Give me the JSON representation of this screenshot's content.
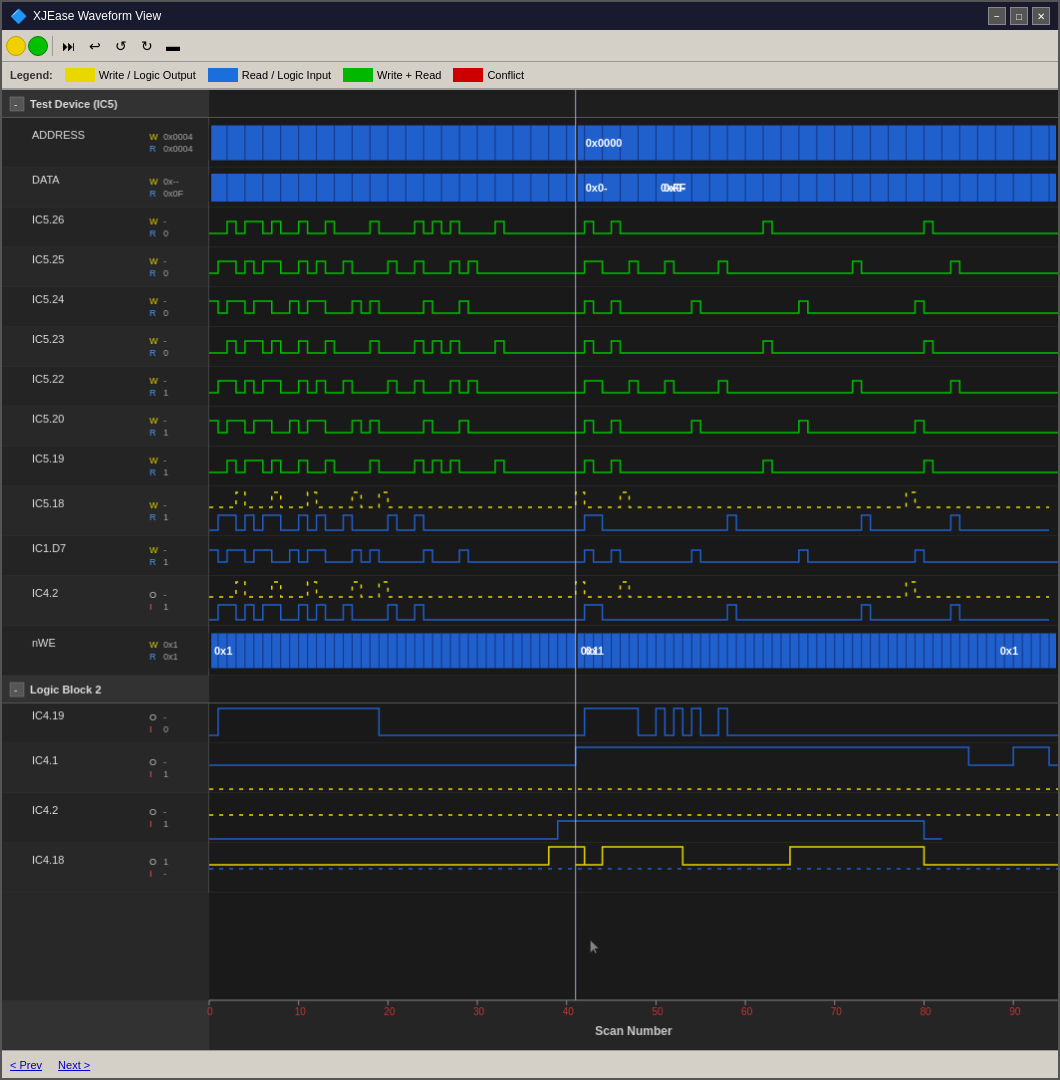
{
  "window": {
    "title": "XJEase Waveform View"
  },
  "legend": {
    "label": "Legend:",
    "items": [
      {
        "label": "Write / Logic Output",
        "color": "#e8d800",
        "class": "leg-yellow"
      },
      {
        "label": "Read / Logic Input",
        "color": "#1a6fdc",
        "class": "leg-blue"
      },
      {
        "label": "Write + Read",
        "color": "#00b800",
        "class": "leg-green"
      },
      {
        "label": "Conflict",
        "color": "#cc0000",
        "class": "leg-red"
      }
    ]
  },
  "groups": [
    {
      "name": "Test Device (IC5)",
      "expanded": true,
      "signals": [
        {
          "name": "ADDRESS",
          "w": "0x0004",
          "r": "0x0004",
          "type": "bus",
          "color": "#1a6fdc",
          "height": 50
        },
        {
          "name": "DATA",
          "w": "0x--",
          "r": "0x0F",
          "type": "bus",
          "color": "#1a6fdc",
          "height": 40
        },
        {
          "name": "IC5.26",
          "w": "-",
          "r": "0",
          "type": "digital",
          "color": "#00c000",
          "height": 40
        },
        {
          "name": "IC5.25",
          "w": "-",
          "r": "0",
          "type": "digital",
          "color": "#00c000",
          "height": 40
        },
        {
          "name": "IC5.24",
          "w": "-",
          "r": "0",
          "type": "digital",
          "color": "#00c000",
          "height": 40
        },
        {
          "name": "IC5.23",
          "w": "-",
          "r": "0",
          "type": "digital",
          "color": "#00c000",
          "height": 40
        },
        {
          "name": "IC5.22",
          "w": "-",
          "r": "1",
          "type": "digital",
          "color": "#00c000",
          "height": 40
        },
        {
          "name": "IC5.20",
          "w": "-",
          "r": "1",
          "type": "digital",
          "color": "#00c000",
          "height": 40
        },
        {
          "name": "IC5.19",
          "w": "-",
          "r": "1",
          "type": "digital",
          "color": "#00c000",
          "height": 40
        },
        {
          "name": "IC5.18",
          "w": "-",
          "r": "1",
          "type": "digital2",
          "color": "#e8d800",
          "height": 50
        },
        {
          "name": "IC1.D7",
          "w": "-",
          "r": "1",
          "type": "digital",
          "color": "#1a6fdc",
          "height": 40
        },
        {
          "name": "IC4.2",
          "o": "-",
          "i": "1",
          "type": "digital2",
          "color_o": "#e8d800",
          "color_i": "#1a6fdc",
          "height": 50
        },
        {
          "name": "nWE",
          "w": "0x1",
          "r": "0x1",
          "type": "bus_dense",
          "color": "#1a6fdc",
          "height": 50
        }
      ]
    },
    {
      "name": "Logic Block 2",
      "expanded": true,
      "signals": [
        {
          "name": "IC4.19",
          "o": "-",
          "i": "0",
          "type": "digital_oi",
          "height": 40
        },
        {
          "name": "IC4.1",
          "o": "-",
          "i": "1",
          "type": "digital_oi",
          "height": 50
        },
        {
          "name": "IC4.2",
          "o": "-",
          "i": "1",
          "type": "digital_oi",
          "height": 50
        },
        {
          "name": "IC4.18",
          "o": "1",
          "i": "-",
          "type": "digital_oi",
          "height": 50
        }
      ]
    }
  ],
  "axis": {
    "label": "Scan Number",
    "ticks": [
      0,
      10,
      20,
      30,
      40,
      50,
      60,
      70,
      80,
      90
    ]
  },
  "statusbar": {
    "prev_label": "< Prev",
    "next_label": "Next >"
  },
  "toolbar": {
    "buttons": [
      "⊖",
      "⊕",
      "⊘"
    ]
  }
}
